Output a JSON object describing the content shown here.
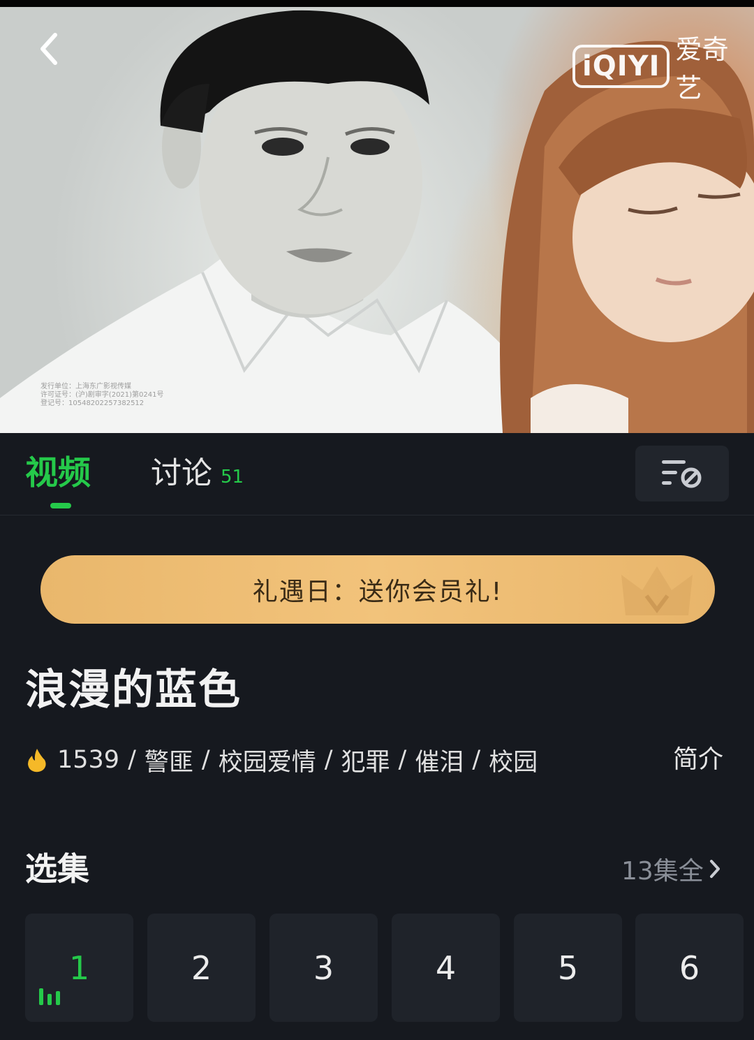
{
  "player": {
    "logo_text": "iQIYI",
    "logo_cn": "爱奇艺",
    "watermark_lines": [
      "发行单位：上海东广影视传媒",
      "许可证号：(沪)剧审字(2021)第0241号",
      "登记号：10548202257382512"
    ]
  },
  "tabs": {
    "video_label": "视频",
    "discuss_label": "讨论",
    "discuss_count": "51"
  },
  "promo": {
    "text": "礼遇日：送你会员礼!"
  },
  "show": {
    "title": "浪漫的蓝色",
    "heat": "1539",
    "tags": [
      "警匪",
      "校园爱情",
      "犯罪",
      "催泪",
      "校园"
    ],
    "intro_label": "简介"
  },
  "episodes": {
    "heading": "选集",
    "total_label": "13集全",
    "items": [
      "1",
      "2",
      "3",
      "4",
      "5",
      "6"
    ],
    "active_index": 0
  },
  "colors": {
    "accent": "#25c94a",
    "background": "#16191f",
    "card": "#1f232a",
    "promo": "#f2c37b"
  },
  "icons": {
    "back": "chevron-left-icon",
    "filter": "filter-settings-icon",
    "heat": "flame-icon",
    "more": "chevron-right-icon",
    "playing": "equalizer-bars-icon",
    "crown": "crown-icon"
  }
}
